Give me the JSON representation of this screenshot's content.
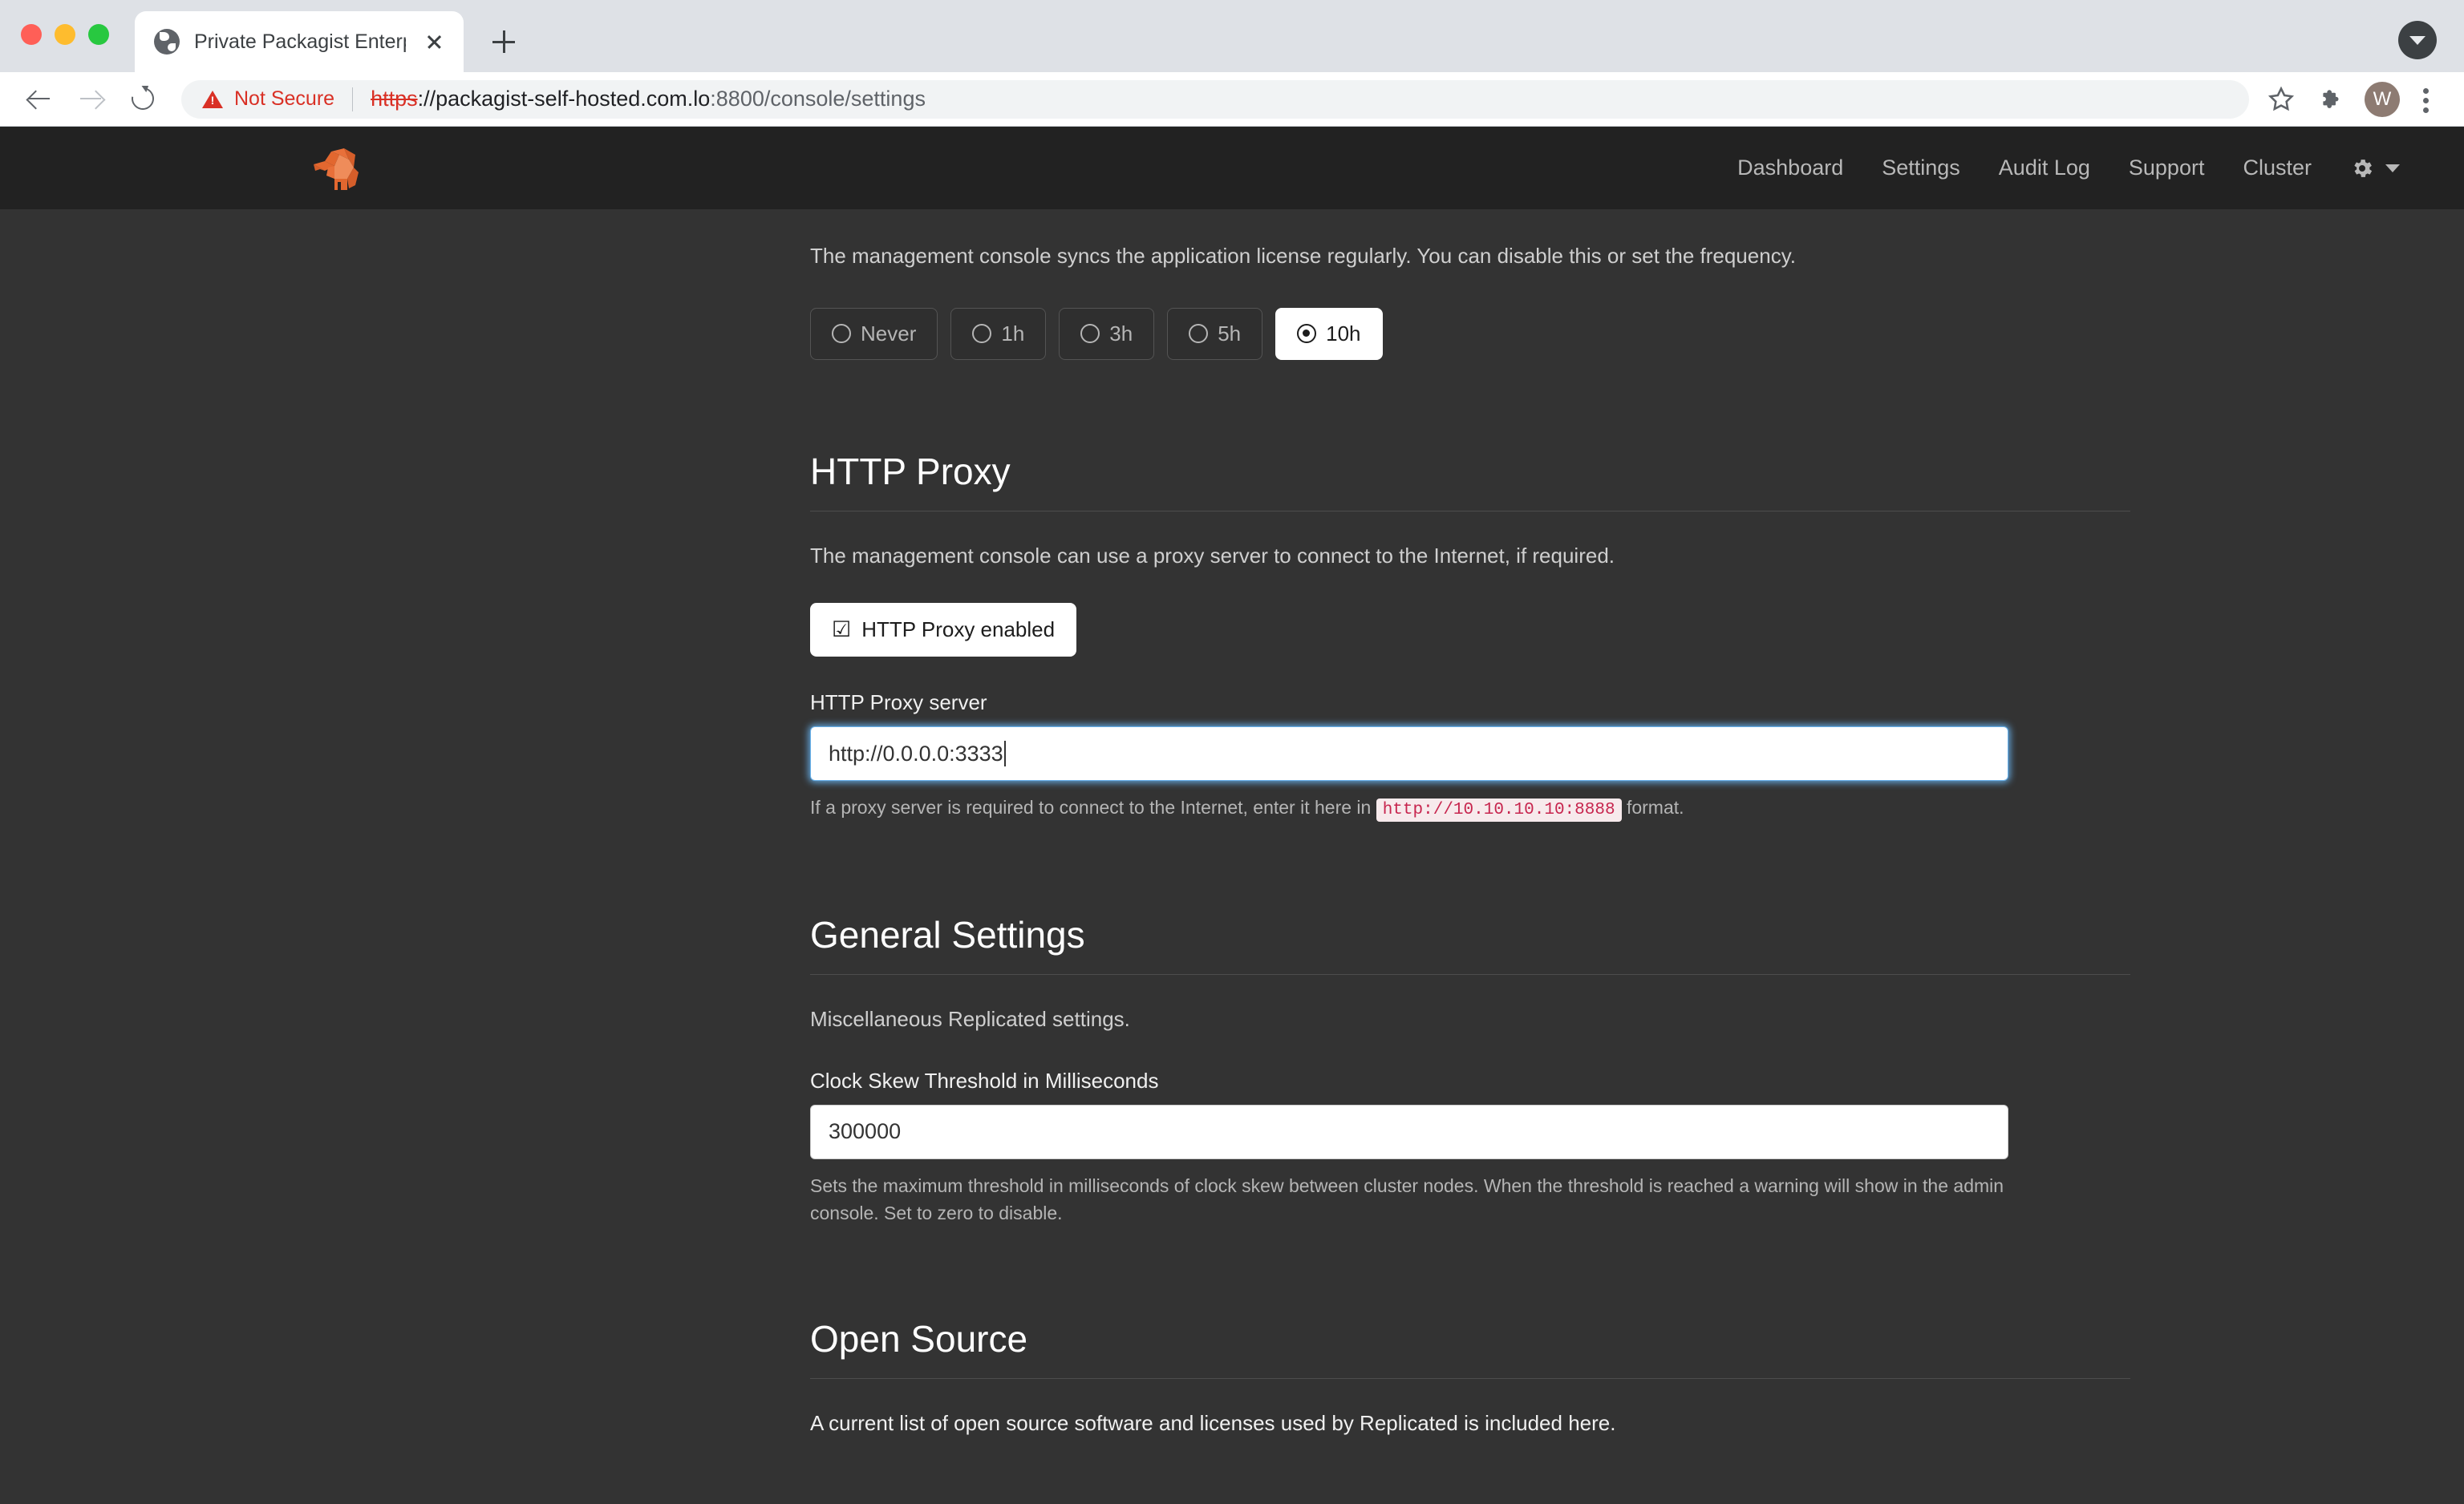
{
  "browser": {
    "tab": {
      "title": "Private Packagist Enterprise",
      "favicon": "globe-icon",
      "close": "×"
    },
    "newtab_label": "+",
    "omnibox": {
      "security_label": "Not Secure",
      "url_scheme_struck": "https",
      "url_scheme_rest": "://",
      "url_host": "packagist-self-hosted.com.lo",
      "url_rest": ":8800/console/settings",
      "full_url": "https://packagist-self-hosted.com.lo:8800/console/settings"
    },
    "profile_initial": "W",
    "icons": {
      "back": "back-arrow-icon",
      "forward": "forward-arrow-icon",
      "reload": "reload-icon",
      "bookmark": "star-icon",
      "extensions": "puzzle-icon",
      "menu": "kebab-menu-icon",
      "tab_list": "tab-list-chevron-icon"
    }
  },
  "appnav": {
    "logo_alt": "replicated-elephant-logo",
    "links": [
      {
        "label": "Dashboard"
      },
      {
        "label": "Settings"
      },
      {
        "label": "Audit Log"
      },
      {
        "label": "Support"
      },
      {
        "label": "Cluster"
      }
    ],
    "gear_icon": "gear-icon"
  },
  "license_sync": {
    "description": "The management console syncs the application license regularly. You can disable this or set the frequency.",
    "options": [
      {
        "label": "Never",
        "selected": false
      },
      {
        "label": "1h",
        "selected": false
      },
      {
        "label": "3h",
        "selected": false
      },
      {
        "label": "5h",
        "selected": false
      },
      {
        "label": "10h",
        "selected": true
      }
    ]
  },
  "http_proxy": {
    "heading": "HTTP Proxy",
    "description": "The management console can use a proxy server to connect to the Internet, if required.",
    "toggle_label": "HTTP Proxy enabled",
    "toggle_checked": true,
    "field_label": "HTTP Proxy server",
    "field_value": "http://0.0.0.0:3333",
    "field_placeholder": "http://10.10.10.10:8888",
    "help_prefix": "If a proxy server is required to connect to the Internet, enter it here in",
    "help_code": "http://10.10.10.10:8888",
    "help_suffix": "format."
  },
  "general_settings": {
    "heading": "General Settings",
    "description": "Miscellaneous Replicated settings.",
    "field_label": "Clock Skew Threshold in Milliseconds",
    "field_value": "300000",
    "field_placeholder": "300000",
    "help_text": "Sets the maximum threshold in milliseconds of clock skew between cluster nodes. When the threshold is reached a warning will show in the admin console. Set to zero to disable."
  },
  "open_source": {
    "heading": "Open Source",
    "description": "A current list of open source software and licenses used by Replicated is included here."
  },
  "colors": {
    "page_bg": "#333333",
    "nav_bg": "#222222",
    "accent_orange": "#e8703a",
    "focus_blue": "#66afe9",
    "danger_red": "#d93025",
    "code_red": "#c7254e"
  }
}
